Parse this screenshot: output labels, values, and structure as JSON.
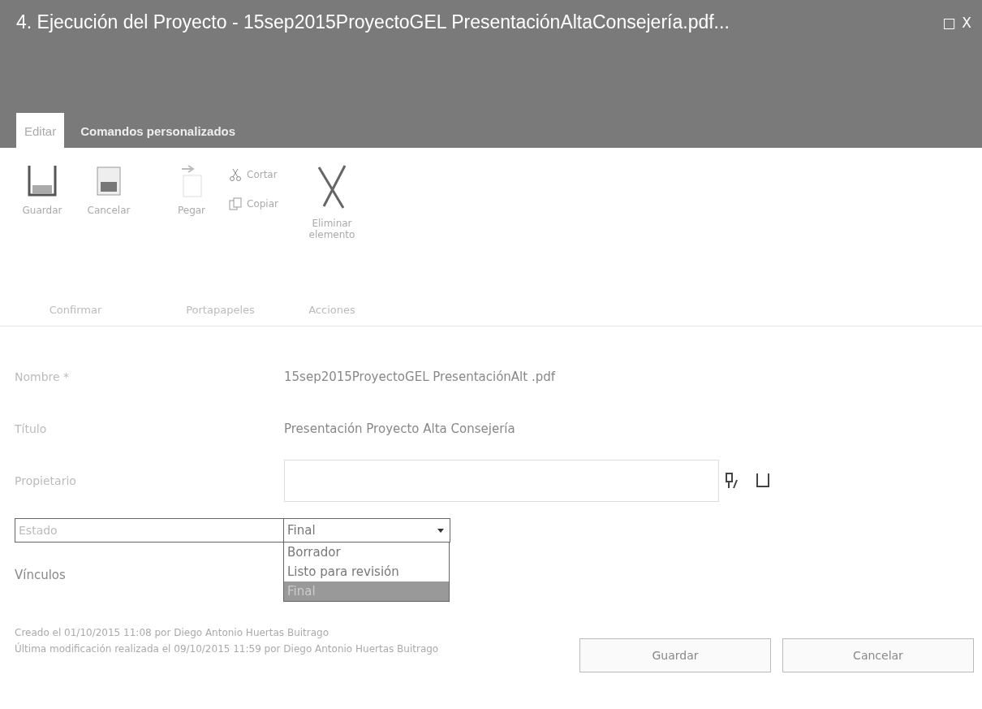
{
  "window": {
    "title": "4. Ejecución del Proyecto - 15sep2015ProyectoGEL PresentaciónAltaConsejería.pdf...",
    "controls": [
      "□",
      "X"
    ]
  },
  "tabs": [
    {
      "label": "Editar",
      "selected": true
    },
    {
      "label": "Comandos personalizados",
      "selected": false
    }
  ],
  "ribbon": {
    "groups": [
      {
        "label": "Confirmar",
        "items": [
          {
            "kind": "large",
            "label": "Guardar"
          },
          {
            "kind": "large",
            "label": "Cancelar"
          }
        ]
      },
      {
        "label": "Portapapeles",
        "items": [
          {
            "kind": "large",
            "label": "Pegar"
          },
          {
            "kind": "small",
            "label": "Cortar"
          },
          {
            "kind": "small",
            "label": "Copiar"
          }
        ]
      },
      {
        "label": "Acciones",
        "items": [
          {
            "kind": "large",
            "label": "Eliminar elemento"
          }
        ]
      }
    ]
  },
  "fields": [
    {
      "kind": "text",
      "label": "Nombre *",
      "value": "15sep2015ProyectoGEL PresentaciónAlt .pdf"
    },
    {
      "kind": "text",
      "label": "Título",
      "value": "Presentación Proyecto Alta Consejería"
    },
    {
      "kind": "people",
      "label": "Propietario"
    },
    {
      "kind": "choice",
      "label": "Estado",
      "value": "Final",
      "options": [
        {
          "label": "Borrador",
          "selected": false
        },
        {
          "label": "Listo para revisión",
          "selected": false
        },
        {
          "label": "Final",
          "selected": true
        }
      ]
    },
    {
      "kind": "heading",
      "label": "Vínculos"
    }
  ],
  "footer": {
    "lines": [
      "Creado el 01/10/2015 11:08 por Diego Antonio Huertas Buitrago",
      "Última modificación realizada el 09/10/2015 11:59 por Diego Antonio Huertas Buitrago"
    ],
    "buttons": [
      "Guardar",
      "Cancelar"
    ]
  }
}
